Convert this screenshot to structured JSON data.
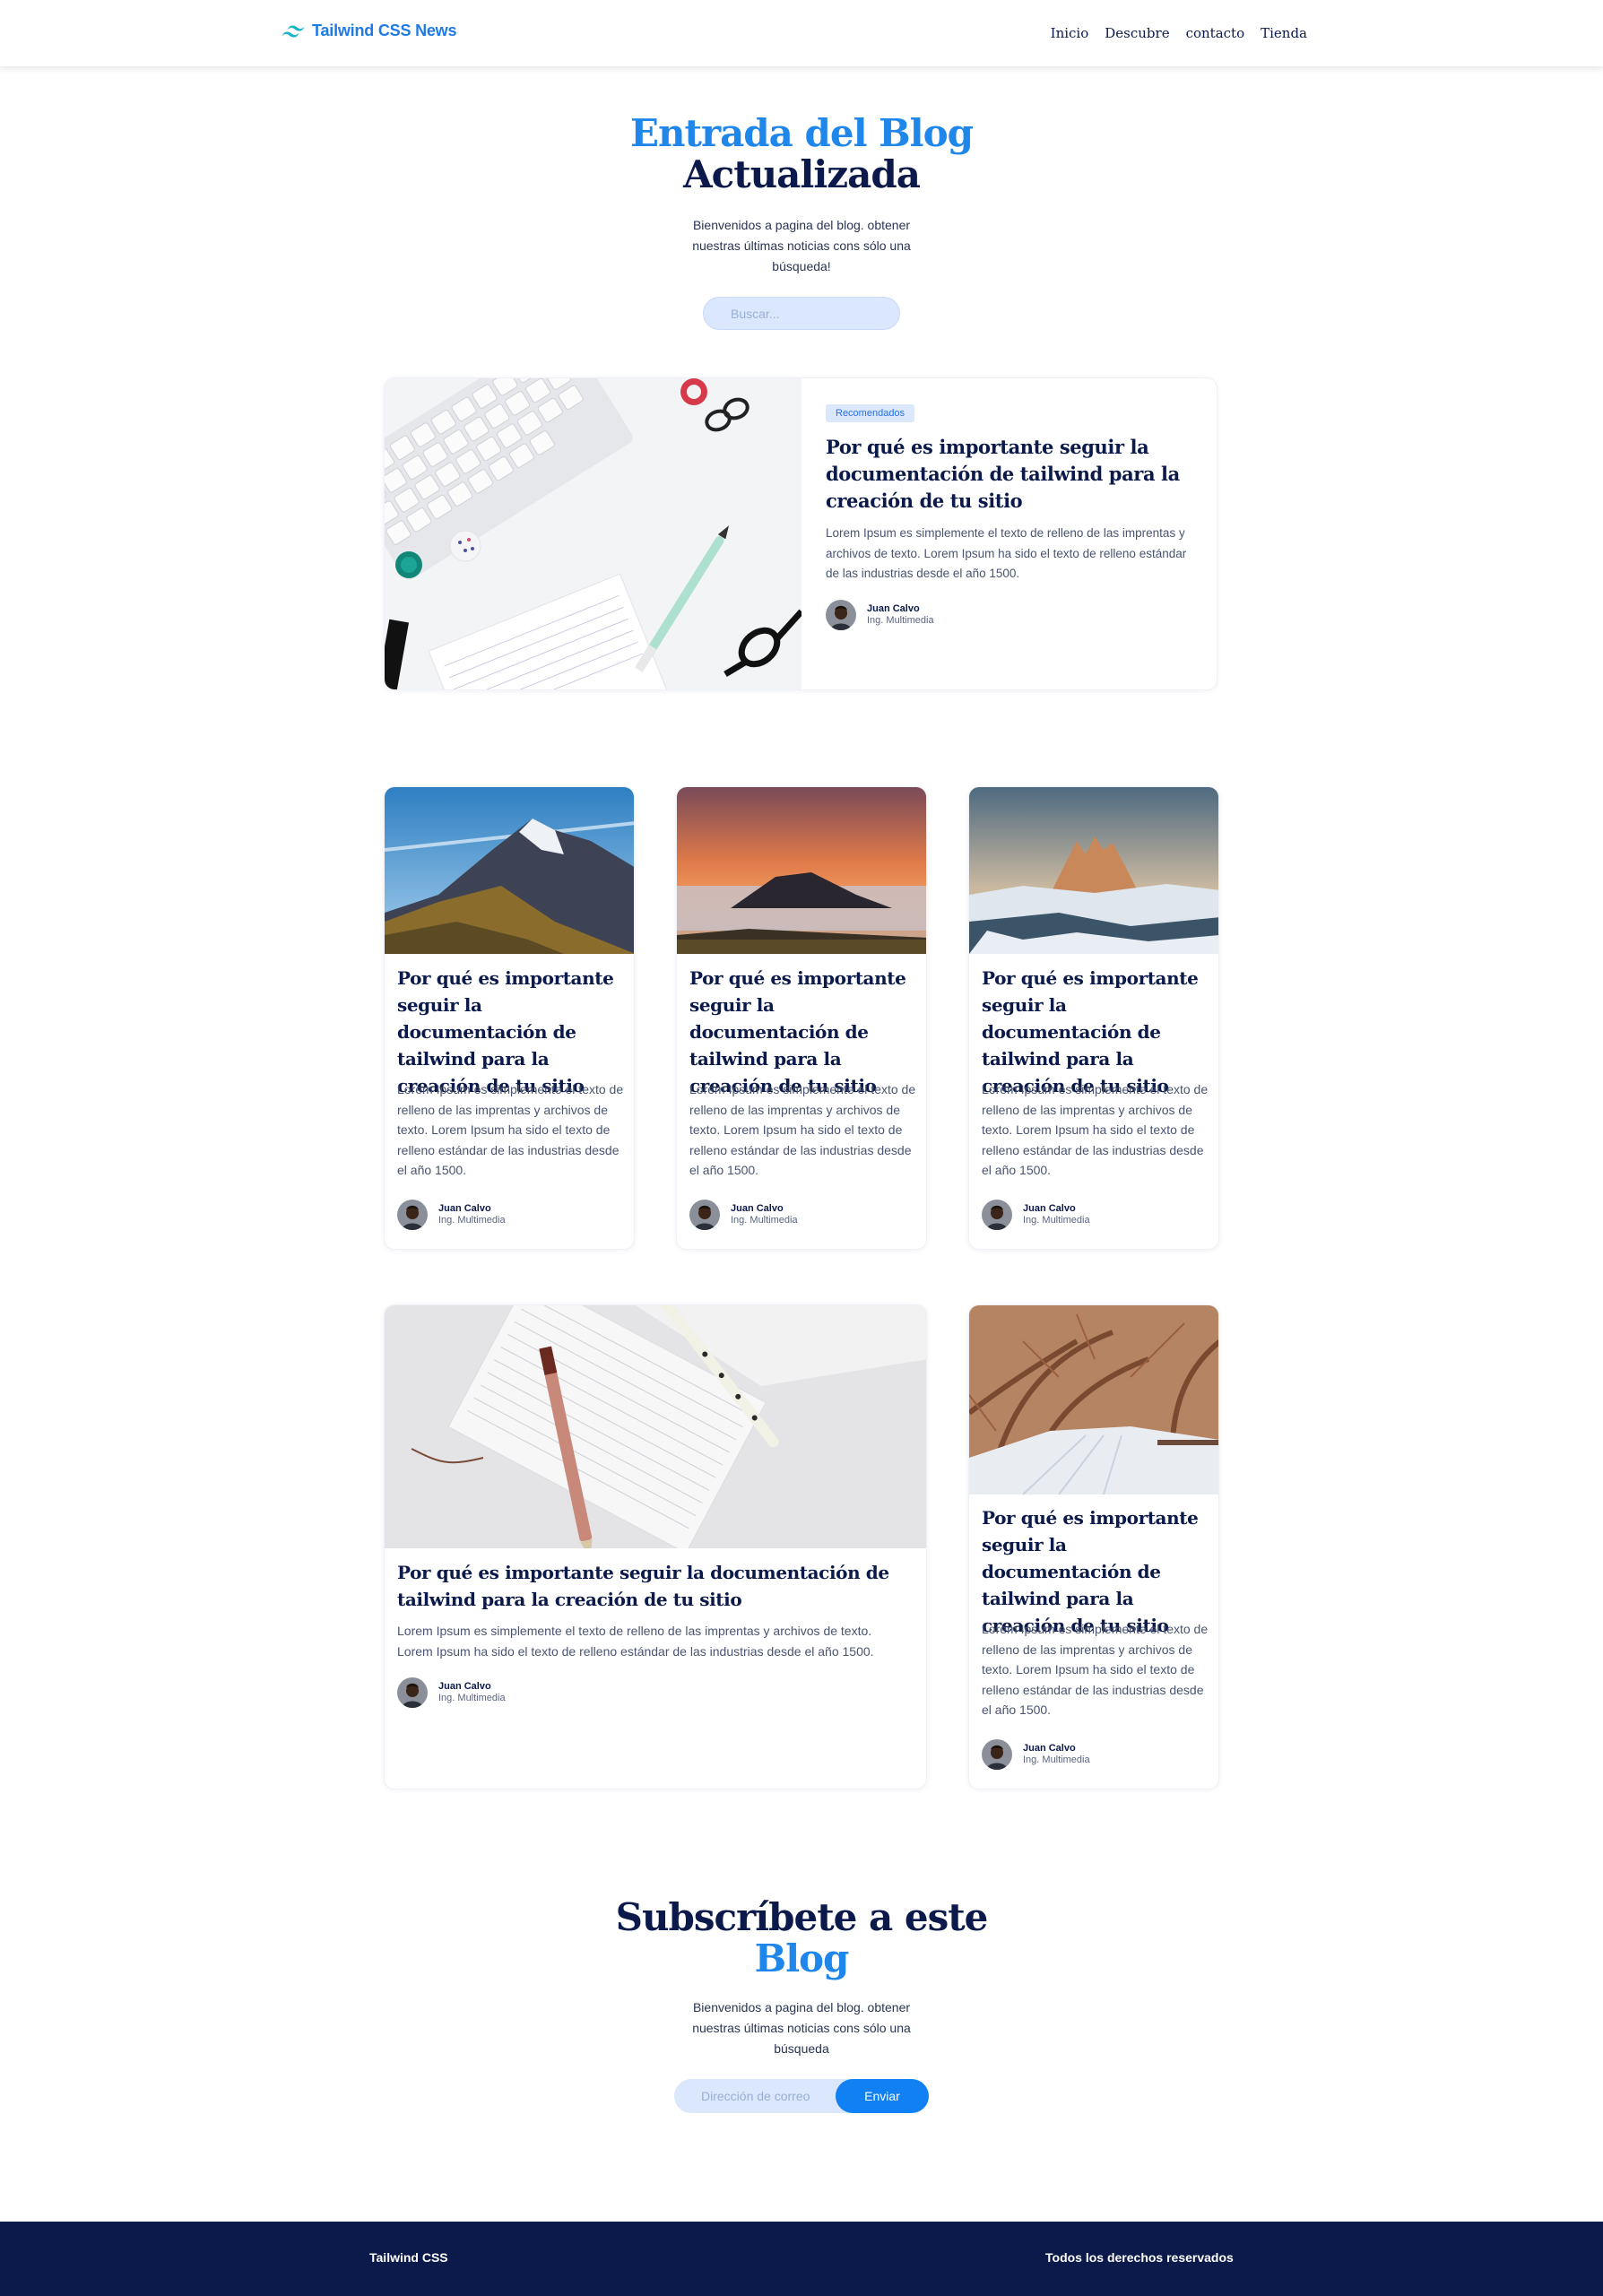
{
  "nav": {
    "brand": "Tailwind CSS News",
    "brand_icon": "tailwind-logo-icon",
    "links": [
      "Inicio",
      "Descubre",
      "contacto",
      "Tienda"
    ]
  },
  "hero": {
    "title_accent": "Entrada del Blog",
    "title_dark": "Actualizada",
    "subtitle": "Bienvenidos a pagina del blog. obtener nuestras últimas noticias cons sólo una búsqueda!",
    "search_placeholder": "Buscar..."
  },
  "featured": {
    "badge": "Recomendados",
    "title": "Por qué es importante seguir la documentación de tailwind para la creación de tu sitio",
    "text": "Lorem Ipsum es simplemente el texto de relleno de las imprentas y archivos de texto. Lorem Ipsum ha sido el texto de relleno estándar de las industrias desde el año 1500.",
    "author": "Juan Calvo",
    "role": "Ing. Multimedia",
    "image": "desk-flatlay-image"
  },
  "posts": [
    {
      "title": "Por qué es importante seguir la documentación de tailwind para la creación de tu sitio",
      "text": "Lorem Ipsum es simplemente el texto de relleno de las imprentas y archivos de texto. Lorem Ipsum ha sido el texto de relleno estándar de las industrias desde el año 1500.",
      "author": "Juan Calvo",
      "role": "Ing. Multimedia",
      "image": "mountain-peak-image"
    },
    {
      "title": "Por qué es importante seguir la documentación de tailwind para la creación de tu sitio",
      "text": "Lorem Ipsum es simplemente el texto de relleno de las imprentas y archivos de texto. Lorem Ipsum ha sido el texto de relleno estándar de las industrias desde el año 1500.",
      "author": "Juan Calvo",
      "role": "Ing. Multimedia",
      "image": "sunset-mountain-image"
    },
    {
      "title": "Por qué es importante seguir la documentación de tailwind para la creación de tu sitio",
      "text": "Lorem Ipsum es simplemente el texto de relleno de las imprentas y archivos de texto. Lorem Ipsum ha sido el texto de relleno estándar de las industrias desde el año 1500.",
      "author": "Juan Calvo",
      "role": "Ing. Multimedia",
      "image": "snowy-peaks-image"
    },
    {
      "title": "Por qué es importante seguir la documentación de tailwind para la creación de tu sitio",
      "text": "Lorem Ipsum es simplemente el texto de relleno de las imprentas y archivos de texto. Lorem Ipsum ha sido el texto de relleno estándar de las industrias desde el año 1500.",
      "author": "Juan Calvo",
      "role": "Ing. Multimedia",
      "image": "notebook-pens-image"
    },
    {
      "title": "Por qué es importante seguir la documentación de tailwind para la creación de tu sitio",
      "text": "Lorem Ipsum es simplemente el texto de relleno de las imprentas y archivos de texto. Lorem Ipsum ha sido el texto de relleno estándar de las industrias desde el año 1500.",
      "author": "Juan Calvo",
      "role": "Ing. Multimedia",
      "image": "winter-trees-image"
    }
  ],
  "subscribe": {
    "title_dark": "Subscríbete a este",
    "title_accent": "Blog",
    "text": "Bienvenidos a pagina del blog. obtener nuestras últimas noticias cons sólo una búsqueda",
    "email_placeholder": "Dirección de correo",
    "button": "Enviar"
  },
  "footer": {
    "left": "Tailwind CSS",
    "right": "Todos los derechos reservados"
  },
  "colors": {
    "accent": "#1f86ea",
    "navy": "#0b1a4a",
    "soft_blue": "#dbe7fd"
  }
}
